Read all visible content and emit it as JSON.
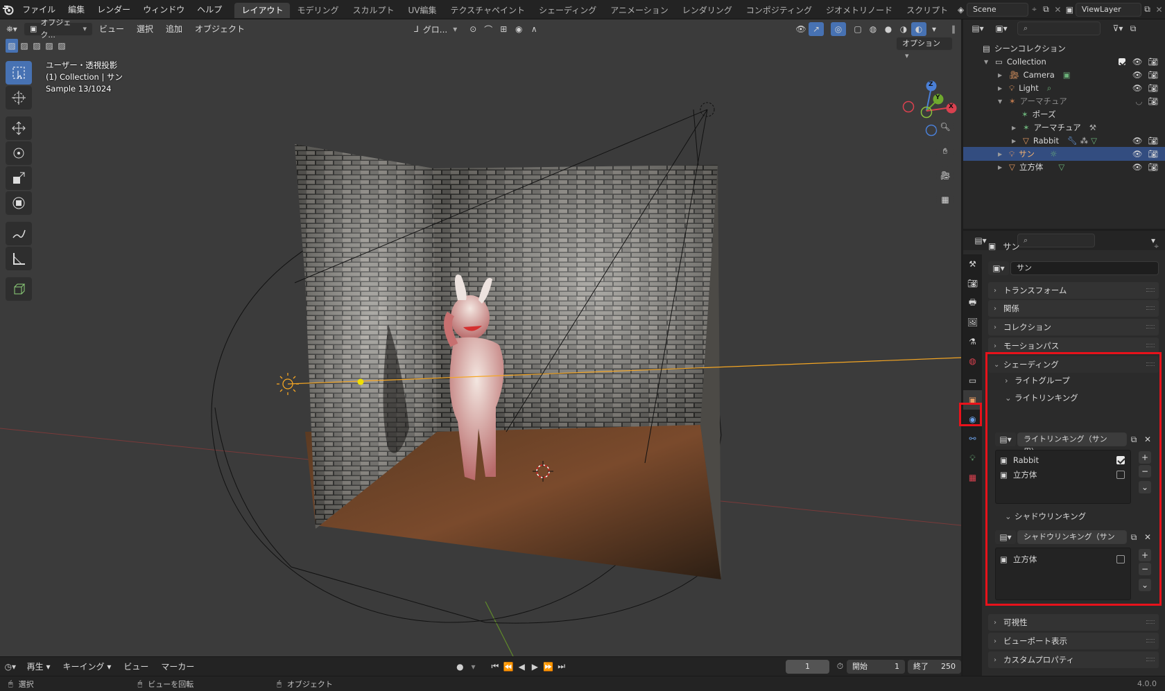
{
  "menubar": {
    "items": [
      "ファイル",
      "編集",
      "レンダー",
      "ウィンドウ",
      "ヘルプ"
    ],
    "workspaces": [
      "レイアウト",
      "モデリング",
      "スカルプト",
      "UV編集",
      "テクスチャペイント",
      "シェーディング",
      "アニメーション",
      "レンダリング",
      "コンポジティング",
      "ジオメトリノード",
      "スクリプト"
    ],
    "active_workspace": "レイアウト",
    "scene": "Scene",
    "view_layer": "ViewLayer"
  },
  "viewport": {
    "header": {
      "mode": "オブジェク...",
      "menus": [
        "ビュー",
        "選択",
        "追加",
        "オブジェクト"
      ],
      "transform_orientation": "グロ...",
      "options": "オプション"
    },
    "overlay": {
      "view_name": "ユーザー・透視投影",
      "collection_info": "(1) Collection | サン",
      "sample": "Sample 13/1024"
    },
    "gizmo_axes": {
      "z": "Z",
      "y": "Y",
      "x": "X"
    }
  },
  "outliner": {
    "root": "シーンコレクション",
    "rows": [
      {
        "label": "Collection",
        "depth": 0
      },
      {
        "label": "Camera",
        "depth": 1
      },
      {
        "label": "Light",
        "depth": 1
      },
      {
        "label": "アーマチュア",
        "depth": 1
      },
      {
        "label": "ポーズ",
        "depth": 2
      },
      {
        "label": "アーマチュア",
        "depth": 2
      },
      {
        "label": "Rabbit",
        "depth": 2
      },
      {
        "label": "サン",
        "depth": 1,
        "selected": true
      },
      {
        "label": "立方体",
        "depth": 1
      }
    ]
  },
  "properties": {
    "object_name": "サン",
    "object_field": "サン",
    "panels": {
      "transform": "トランスフォーム",
      "relations": "関係",
      "collection": "コレクション",
      "motion_path": "モーションパス",
      "shading": "シェーディング",
      "light_group": "ライトグループ",
      "light_linking": "ライトリンキング",
      "light_linking_collection": "ライトリンキング（サン 用）",
      "shadow_linking": "シャドウリンキング",
      "shadow_linking_collection": "シャドウリンキング（サン ...",
      "visibility": "可視性",
      "viewport_display": "ビューポート表示",
      "custom_props": "カスタムプロパティ"
    },
    "light_linking_items": [
      {
        "name": "Rabbit",
        "checked": true
      },
      {
        "name": "立方体",
        "checked": false
      }
    ],
    "shadow_linking_items": [
      {
        "name": "立方体",
        "checked": false
      }
    ]
  },
  "timeline": {
    "playback": "再生",
    "keying": "キーイング",
    "view": "ビュー",
    "marker": "マーカー",
    "current_frame": "1",
    "start_label": "開始",
    "start": "1",
    "end_label": "終了",
    "end": "250"
  },
  "statusbar": {
    "select": "選択",
    "rotate_view": "ビューを回転",
    "object": "オブジェクト",
    "version": "4.0.0"
  },
  "colors": {
    "accent": "#4772b3",
    "selected_row": "#334d80",
    "highlight_red": "#e8121b",
    "light_orange": "#f5a623"
  }
}
